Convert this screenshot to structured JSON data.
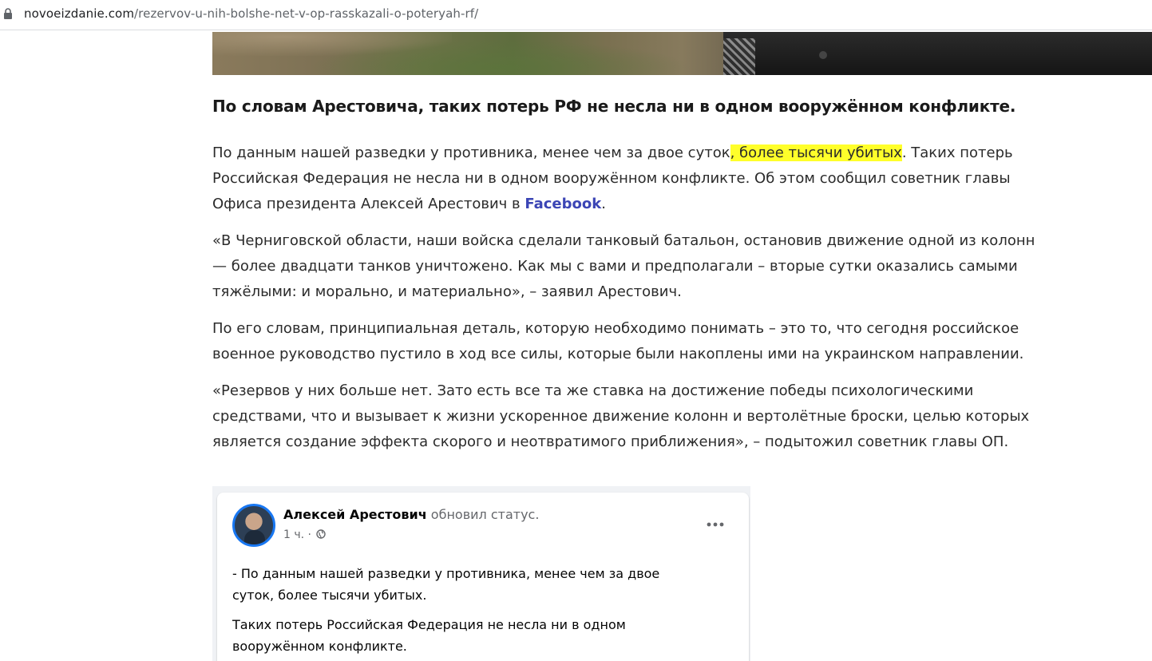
{
  "browser": {
    "url_domain": "novoeizdanie.com",
    "url_path": "/rezervov-u-nih-bolshe-net-v-op-rasskazali-o-poteryah-rf/"
  },
  "article": {
    "lead": "По словам Арестовича, таких потерь РФ не несла ни в одном вооружённом конфликте.",
    "p1": {
      "line1_before": "По данным нашей разведки у противника, менее чем за двое суток",
      "line1_highlight": ", более тысячи убитых",
      "line1_after": ". Таких потерь",
      "line2": "Российская Федерация не несла ни в одном вооружённом конфликте. Об этом сообщил советник главы",
      "line3_before": "Офиса президента Алексей Арестович в ",
      "line3_link": "Facebook",
      "line3_after": "."
    },
    "p2": {
      "line1": "«В Черниговской области, наши войска сделали танковый батальон, остановив движение одной из колонн",
      "line2": "— более двадцати танков уничтожено. Как мы с вами и предполагали – вторые сутки оказались самыми",
      "line3": "тяжёлыми: и морально, и материально», – заявил Арестович."
    },
    "p3": {
      "line1": "По его словам, принципиальная деталь, которую необходимо понимать – это то, что сегодня российское",
      "line2": "военное руководство пустило в ход все силы, которые были накоплены ими на украинском направлении."
    },
    "p4": {
      "line1": "«Резервов у них больше нет. Зато есть все та же ставка на достижение победы психологическими",
      "line2": "средствами, что и вызывает к жизни ускоренное движение колонн и вертолётные броски, целью которых",
      "line3": "является создание эффекта скорого и неотвратимого приближения», – подытожил советник главы ОП."
    }
  },
  "facebook_post": {
    "author": "Алексей Арестович",
    "action": "обновил статус.",
    "time": "1 ч. ·",
    "more": "•••",
    "text1_line1": "- По данным нашей разведки у противника, менее чем за двое",
    "text1_line2": "суток, более тысячи убитых.",
    "text2_line1": "Таких потерь Российская Федерация не несла ни в одном",
    "text2_line2": "вооружённом конфликте."
  },
  "colors": {
    "highlight": "#ffff2a",
    "link": "#3b45b5",
    "fb_blue": "#1877f2"
  }
}
